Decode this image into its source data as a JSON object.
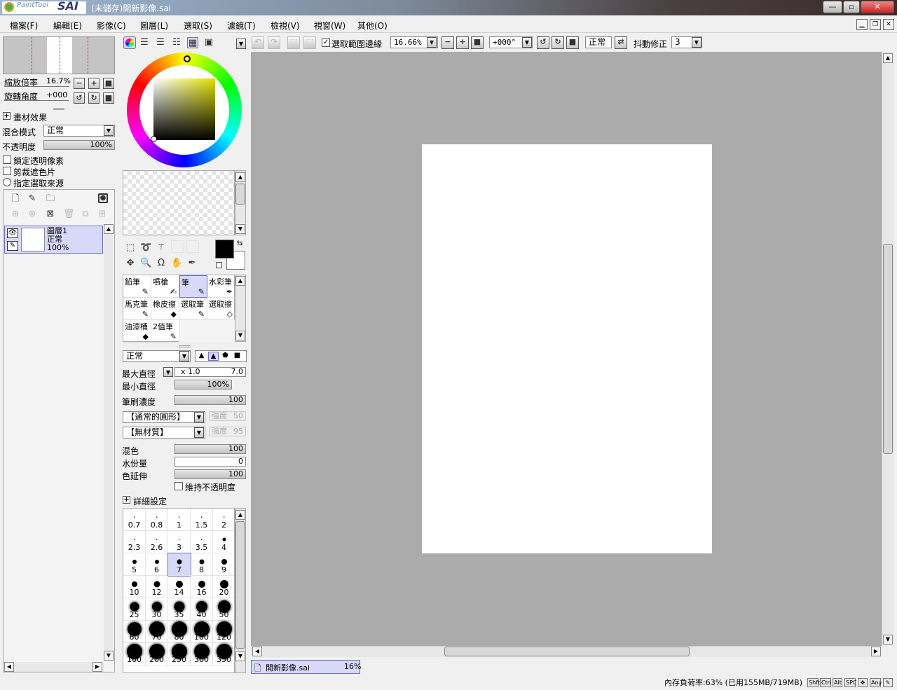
{
  "window": {
    "title": "(未儲存)開新影像.sai",
    "logo_text": "PaintTool",
    "logo_brand": "SAI"
  },
  "menu": [
    "檔案(F)",
    "編輯(E)",
    "影像(C)",
    "圖層(L)",
    "選取(S)",
    "濾鏡(T)",
    "檢視(V)",
    "視窗(W)",
    "其他(O)"
  ],
  "navigator": {
    "zoom_label": "縮放倍率",
    "zoom_value": "16.7%",
    "rotate_label": "旋轉角度",
    "rotate_value": "+000"
  },
  "layer_props": {
    "effects_label": "畫材效果",
    "blend_label": "混合模式",
    "blend_value": "正常",
    "opacity_label": "不透明度",
    "opacity_value": "100%",
    "lock_alpha": "鎖定透明像素",
    "clip": "剪裁遮色片",
    "sel_source": "指定選取來源"
  },
  "layer": {
    "name": "圖層1",
    "mode": "正常",
    "opacity": "100%"
  },
  "toolbar": {
    "show_sel_edge": "選取範圍邊緣",
    "zoom": "16.66%",
    "angle": "+000°",
    "mode": "正常",
    "stab_label": "抖動修正",
    "stab_value": "3"
  },
  "tools": [
    {
      "name": "鉛筆"
    },
    {
      "name": "噴槍"
    },
    {
      "name": "筆"
    },
    {
      "name": "水彩筆"
    },
    {
      "name": "馬克筆"
    },
    {
      "name": "橡皮擦"
    },
    {
      "name": "選取筆"
    },
    {
      "name": "選取擦"
    },
    {
      "name": "油漆桶"
    },
    {
      "name": "2值筆"
    }
  ],
  "brush": {
    "mode": "正常",
    "max_size_label": "最大直徑",
    "max_size_mult": "x 1.0",
    "max_size_value": "7.0",
    "min_size_label": "最小直徑",
    "min_size_value": "100%",
    "density_label": "筆刷濃度",
    "density_value": "100",
    "shape": "【通常的圓形】",
    "shape_strength_label": "強度",
    "shape_strength": "50",
    "texture": "【無材質】",
    "tex_strength_label": "強度",
    "tex_strength": "95",
    "blend_label": "混色",
    "blend_value": "100",
    "water_label": "水份量",
    "water_value": "0",
    "persist_label": "色延伸",
    "persist_value": "100",
    "keep_opacity": "維持不透明度",
    "advanced": "詳細設定"
  },
  "brush_sizes": [
    "0.7",
    "0.8",
    "1",
    "1.5",
    "2",
    "2.3",
    "2.6",
    "3",
    "3.5",
    "4",
    "5",
    "6",
    "7",
    "8",
    "9",
    "10",
    "12",
    "14",
    "16",
    "20",
    "25",
    "30",
    "35",
    "40",
    "50",
    "60",
    "70",
    "80",
    "100",
    "120",
    "160",
    "200",
    "250",
    "300",
    "350"
  ],
  "selected_size": "7",
  "doc_tab": {
    "name": "開新影像.sai",
    "zoom": "16%"
  },
  "status": {
    "memory": "內存負荷率:63% (已用155MB/719MB)",
    "keys": [
      "Shft",
      "Ctrl",
      "Alt",
      "SPC",
      "Any"
    ]
  },
  "colors": {
    "accent": "#d8d8f8",
    "canvas_bg": "#ababab",
    "current_fg": "#000000",
    "current_bg": "#ffffff"
  }
}
